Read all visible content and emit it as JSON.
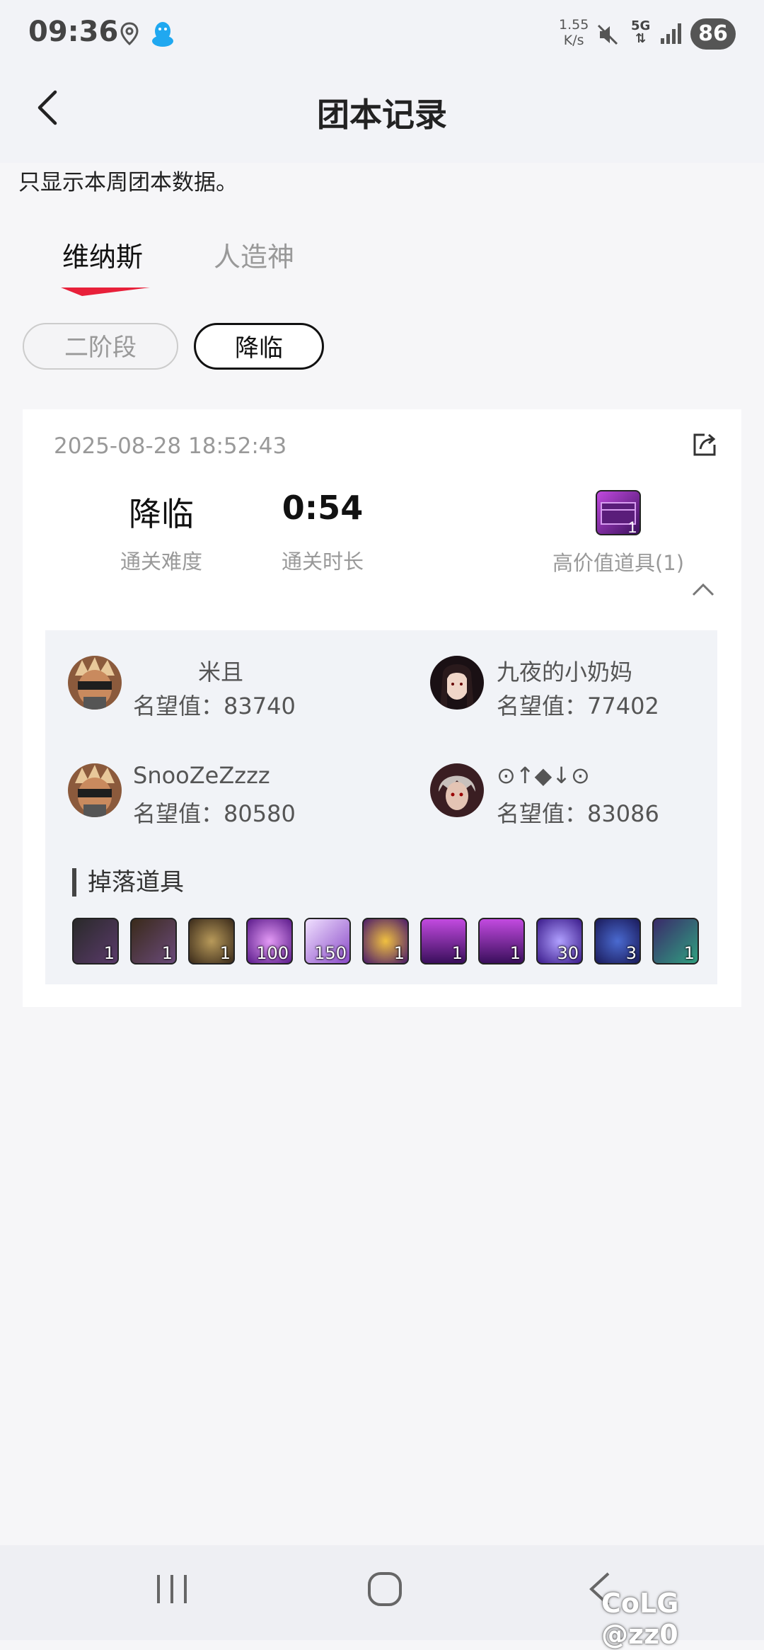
{
  "status_bar": {
    "time": "09:36",
    "speed_value": "1.55",
    "speed_unit": "K/s",
    "network": "5G",
    "battery": "86"
  },
  "header": {
    "title": "团本记录"
  },
  "notice": "只显示本周团本数据。",
  "tabs": [
    {
      "label": "维纳斯",
      "active": true
    },
    {
      "label": "人造神",
      "active": false
    }
  ],
  "phase_filters": [
    {
      "label": "二阶段",
      "selected": false
    },
    {
      "label": "降临",
      "selected": true
    }
  ],
  "record": {
    "datetime": "2025-08-28 18:52:43",
    "difficulty_value": "降临",
    "difficulty_label": "通关难度",
    "duration_value": "0:54",
    "duration_label": "通关时长",
    "high_value_count": "1",
    "high_value_label": "高价值道具(1)",
    "fame_prefix": "名望值：",
    "players": [
      {
        "name": "米且",
        "fame": "83740",
        "avatar": "masked-fighter-avatar"
      },
      {
        "name": "九夜的小奶妈",
        "fame": "77402",
        "avatar": "dark-haired-woman-avatar"
      },
      {
        "name": "SnooZeZzzz",
        "fame": "80580",
        "avatar": "masked-fighter-avatar"
      },
      {
        "name": "⊙↑◆↓⊙",
        "fame": "83086",
        "avatar": "silver-haired-avatar"
      }
    ],
    "drops_title": "掉落道具",
    "drops": [
      "1",
      "1",
      "1",
      "100",
      "150",
      "1",
      "1",
      "1",
      "30",
      "3",
      "1"
    ]
  },
  "watermark": "@zz0",
  "colors": {
    "accent": "#e8203a",
    "page_bg": "#f6f6f8",
    "card_bg": "#ffffff",
    "inner_bg": "#f1f3f7"
  }
}
